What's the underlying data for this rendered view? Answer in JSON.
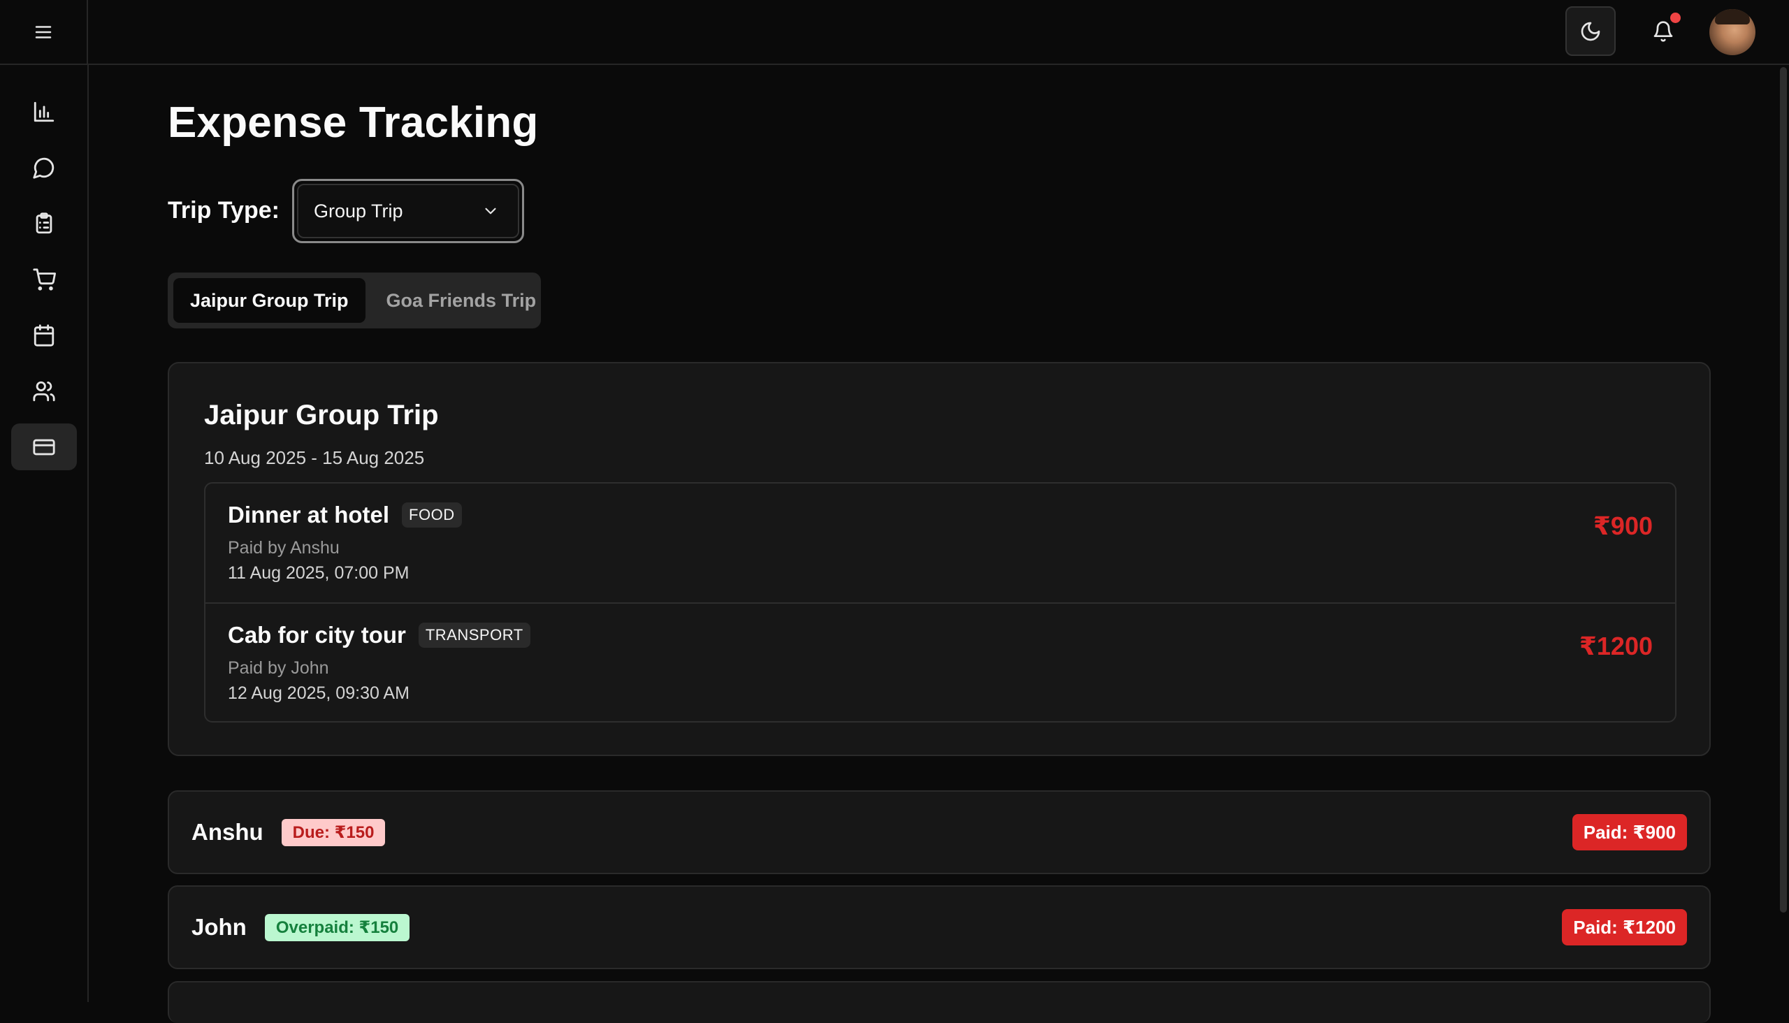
{
  "header": {
    "menu_icon": "hamburger-icon",
    "theme_icon": "moon-icon",
    "notification_icon": "bell-icon",
    "notification_dot_color": "#ef4444"
  },
  "sidebar": {
    "items": [
      {
        "icon": "bar-chart-icon",
        "active": false
      },
      {
        "icon": "message-circle-icon",
        "active": false
      },
      {
        "icon": "clipboard-list-icon",
        "active": false
      },
      {
        "icon": "shopping-cart-icon",
        "active": false
      },
      {
        "icon": "calendar-icon",
        "active": false
      },
      {
        "icon": "users-icon",
        "active": false
      },
      {
        "icon": "credit-card-icon",
        "active": true
      }
    ]
  },
  "main": {
    "title": "Expense Tracking",
    "trip_type_label": "Trip Type:",
    "trip_type_value": "Group Trip",
    "tabs": [
      {
        "label": "Jaipur Group Trip",
        "active": true
      },
      {
        "label": "Goa Friends Trip",
        "active": false
      }
    ],
    "trip": {
      "name": "Jaipur Group Trip",
      "dates": "10 Aug 2025 - 15 Aug 2025",
      "expenses": [
        {
          "name": "Dinner at hotel",
          "category": "FOOD",
          "paid_by": "Paid by Anshu",
          "datetime": "11 Aug 2025, 07:00 PM",
          "amount": "₹900"
        },
        {
          "name": "Cab for city tour",
          "category": "TRANSPORT",
          "paid_by": "Paid by John",
          "datetime": "12 Aug 2025, 09:30 AM",
          "amount": "₹1200"
        }
      ]
    },
    "members": [
      {
        "name": "Anshu",
        "status": "Due: ₹150",
        "paid": "Paid: ₹900"
      },
      {
        "name": "John",
        "status": "Overpaid: ₹150",
        "paid": "Paid: ₹1200"
      }
    ]
  },
  "colors": {
    "background": "#0a0a0a",
    "card": "#171717",
    "amount_red": "#dc2626",
    "due_bg": "#fecaca",
    "overpaid_bg": "#bbf7d0"
  }
}
